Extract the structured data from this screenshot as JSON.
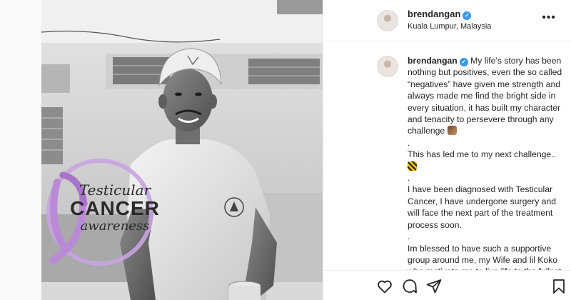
{
  "post": {
    "username": "brendangan",
    "location": "Kuala Lumpur, Malaysia",
    "verified_glyph": "✓",
    "more_glyph": "•••",
    "caption": [
      "My life’s story has been nothing but positives, even the so called “negatives” have given me strength and always made me find the bright side in every situation, it has built my character and tenacity to persevere through any challenge",
      ".",
      "This has led me to my next challenge..",
      ".",
      "I have been diagnosed with Testicular Cancer, I have undergone surgery and will face the next part of the treatment process soon.",
      ".",
      "Im blessed to have such a supportive group around me, my Wife and lil Koko who motivate me to live life to the fullest, my beautiful family who"
    ]
  },
  "overlay": {
    "line1": "Testicular",
    "line2": "CANCER",
    "line3": "awareness",
    "ribbon_color": "#b98ad6"
  },
  "icons": {
    "like": "heart-icon",
    "comment": "comment-icon",
    "share": "share-icon",
    "save": "bookmark-icon"
  },
  "colors": {
    "verified": "#3897f0",
    "text": "#262626",
    "border": "#efefef"
  }
}
